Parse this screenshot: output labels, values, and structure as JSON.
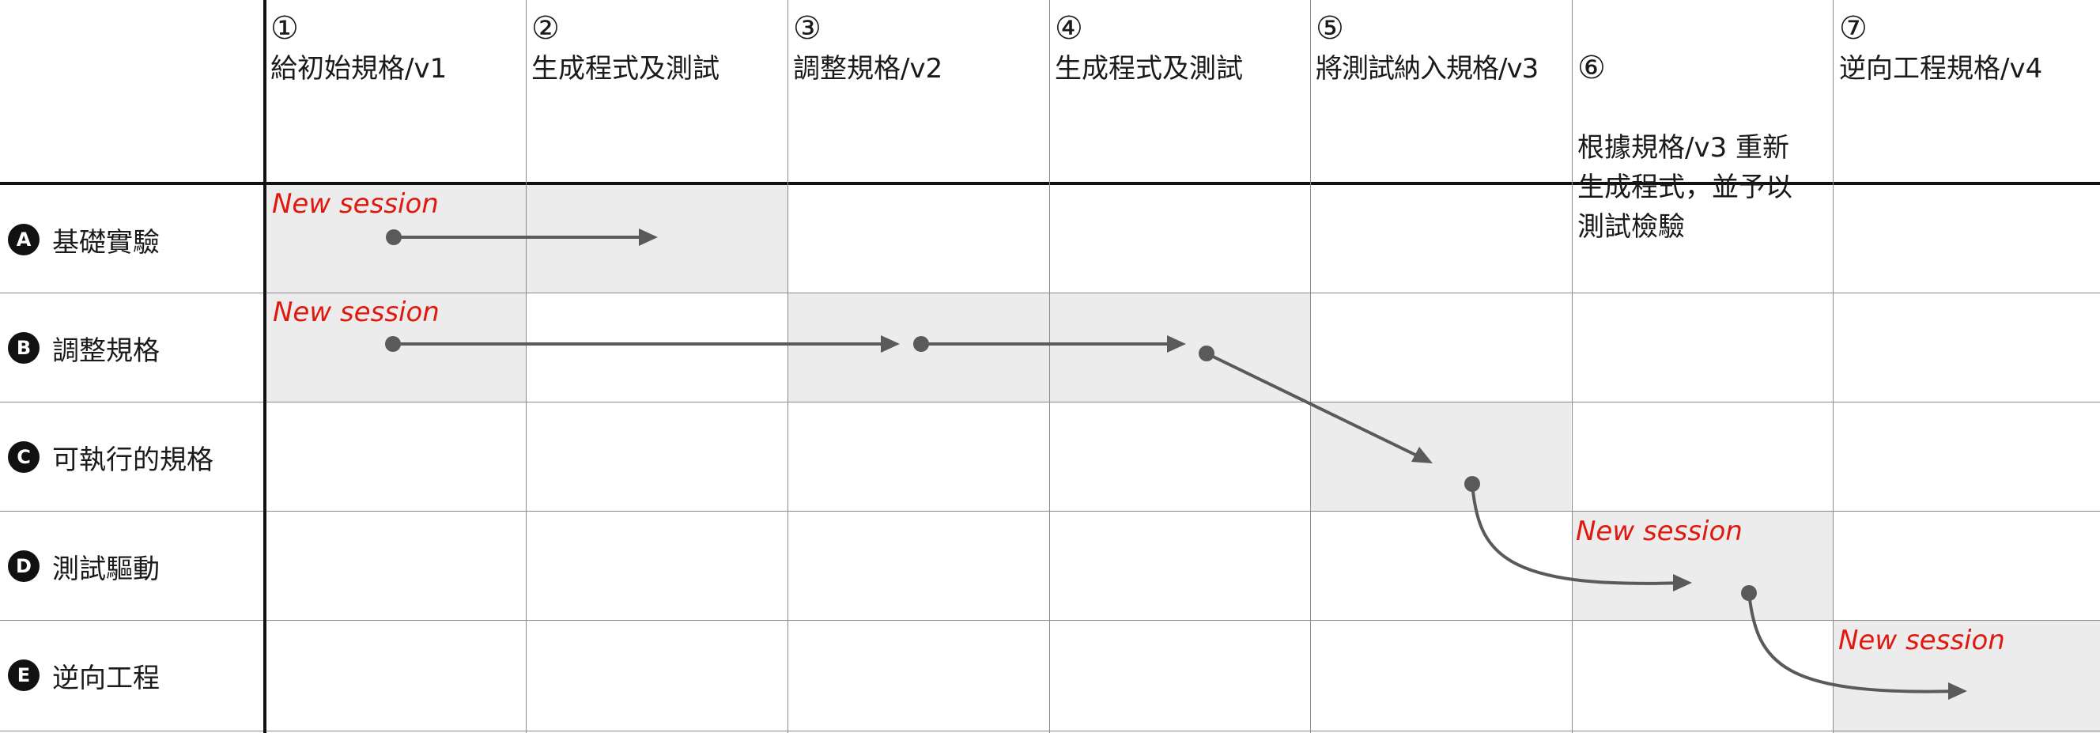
{
  "columns": [
    {
      "num": "①",
      "title": "給初始規格/v1"
    },
    {
      "num": "②",
      "title": "生成程式及測試"
    },
    {
      "num": "③",
      "title": "調整規格/v2"
    },
    {
      "num": "④",
      "title": "生成程式及測試"
    },
    {
      "num": "⑤",
      "title": "將測試納入規格/v3"
    },
    {
      "num": "⑥",
      "title": "根據規格/v3 重新\n生成程式，並予以\n測試檢驗"
    },
    {
      "num": "⑦",
      "title": "逆向工程規格/v4"
    }
  ],
  "rows": [
    {
      "badge": "A",
      "label": "基礎實驗",
      "session_label": "New session"
    },
    {
      "badge": "B",
      "label": "調整規格",
      "session_label": "New session"
    },
    {
      "badge": "C",
      "label": "可執行的規格",
      "session_label": ""
    },
    {
      "badge": "D",
      "label": "測試驅動",
      "session_label": "New session"
    },
    {
      "badge": "E",
      "label": "逆向工程",
      "session_label": "New session"
    }
  ],
  "colors": {
    "shade": "#ececec",
    "arrow": "#5a5a5a",
    "session_text": "#e0180e",
    "grid": "#8a8a8a"
  }
}
